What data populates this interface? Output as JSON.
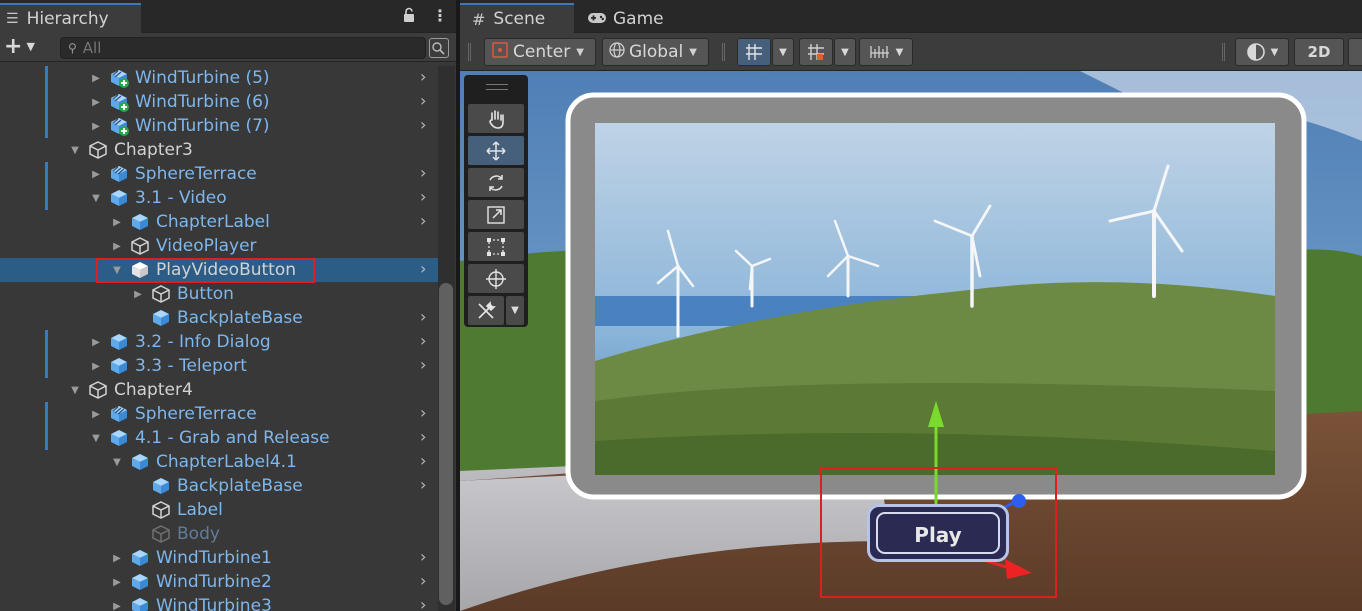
{
  "hierarchy": {
    "tab_label": "Hierarchy",
    "search_placeholder": "All",
    "rows": [
      {
        "label": "WindTurbine (5)",
        "style": "blue",
        "icon": "prefab-variant",
        "expanded": false,
        "has_children": true,
        "chevron": true,
        "mark": true
      },
      {
        "label": "WindTurbine (6)",
        "style": "blue",
        "icon": "prefab-variant",
        "expanded": false,
        "has_children": true,
        "chevron": true,
        "mark": true
      },
      {
        "label": "WindTurbine (7)",
        "style": "blue",
        "icon": "prefab-variant",
        "expanded": false,
        "has_children": true,
        "chevron": true,
        "mark": true
      },
      {
        "label": "Chapter3",
        "style": "white",
        "icon": "gameobject",
        "expanded": true,
        "has_children": true,
        "chevron": false,
        "mark": false
      },
      {
        "label": "SphereTerrace",
        "style": "blue",
        "icon": "prefab-striped",
        "expanded": false,
        "has_children": true,
        "chevron": true,
        "mark": true
      },
      {
        "label": "3.1 - Video",
        "style": "blue",
        "icon": "prefab",
        "expanded": true,
        "has_children": true,
        "chevron": true,
        "mark": true
      },
      {
        "label": "ChapterLabel",
        "style": "blue",
        "icon": "prefab",
        "expanded": false,
        "has_children": true,
        "chevron": true,
        "mark": false
      },
      {
        "label": "VideoPlayer",
        "style": "blue",
        "icon": "gameobject",
        "expanded": false,
        "has_children": true,
        "chevron": false,
        "mark": false
      },
      {
        "label": "PlayVideoButton",
        "style": "white",
        "icon": "prefab-white",
        "expanded": true,
        "has_children": true,
        "chevron": true,
        "mark": false,
        "selected": true
      },
      {
        "label": "Button",
        "style": "blue",
        "icon": "gameobject",
        "expanded": false,
        "has_children": true,
        "chevron": false,
        "mark": false
      },
      {
        "label": "BackplateBase",
        "style": "blue",
        "icon": "prefab",
        "expanded": false,
        "has_children": false,
        "chevron": true,
        "mark": false
      },
      {
        "label": "3.2 - Info Dialog",
        "style": "blue",
        "icon": "prefab",
        "expanded": false,
        "has_children": true,
        "chevron": true,
        "mark": true
      },
      {
        "label": "3.3 - Teleport",
        "style": "blue",
        "icon": "prefab",
        "expanded": false,
        "has_children": true,
        "chevron": true,
        "mark": true
      },
      {
        "label": "Chapter4",
        "style": "white",
        "icon": "gameobject",
        "expanded": true,
        "has_children": true,
        "chevron": false,
        "mark": false
      },
      {
        "label": "SphereTerrace",
        "style": "blue",
        "icon": "prefab-striped",
        "expanded": false,
        "has_children": true,
        "chevron": true,
        "mark": true
      },
      {
        "label": "4.1 - Grab and Release",
        "style": "blue",
        "icon": "prefab",
        "expanded": true,
        "has_children": true,
        "chevron": true,
        "mark": true
      },
      {
        "label": "ChapterLabel4.1",
        "style": "blue",
        "icon": "prefab",
        "expanded": true,
        "has_children": true,
        "chevron": true,
        "mark": false
      },
      {
        "label": "BackplateBase",
        "style": "blue",
        "icon": "prefab",
        "expanded": false,
        "has_children": false,
        "chevron": true,
        "mark": false
      },
      {
        "label": "Label",
        "style": "blue",
        "icon": "gameobject",
        "expanded": false,
        "has_children": false,
        "chevron": false,
        "mark": false
      },
      {
        "label": "Body",
        "style": "dim",
        "icon": "gameobject-dim",
        "expanded": false,
        "has_children": false,
        "chevron": false,
        "mark": false
      },
      {
        "label": "WindTurbine1",
        "style": "blue",
        "icon": "prefab",
        "expanded": false,
        "has_children": true,
        "chevron": true,
        "mark": false
      },
      {
        "label": "WindTurbine2",
        "style": "blue",
        "icon": "prefab",
        "expanded": false,
        "has_children": true,
        "chevron": true,
        "mark": false
      },
      {
        "label": "WindTurbine3",
        "style": "blue",
        "icon": "prefab",
        "expanded": false,
        "has_children": true,
        "chevron": true,
        "mark": false
      }
    ]
  },
  "scene": {
    "tab_scene": "Scene",
    "tab_game": "Game",
    "pivot_label": "Center",
    "space_label": "Global",
    "mode_2d": "2D",
    "button_label": "Play"
  }
}
